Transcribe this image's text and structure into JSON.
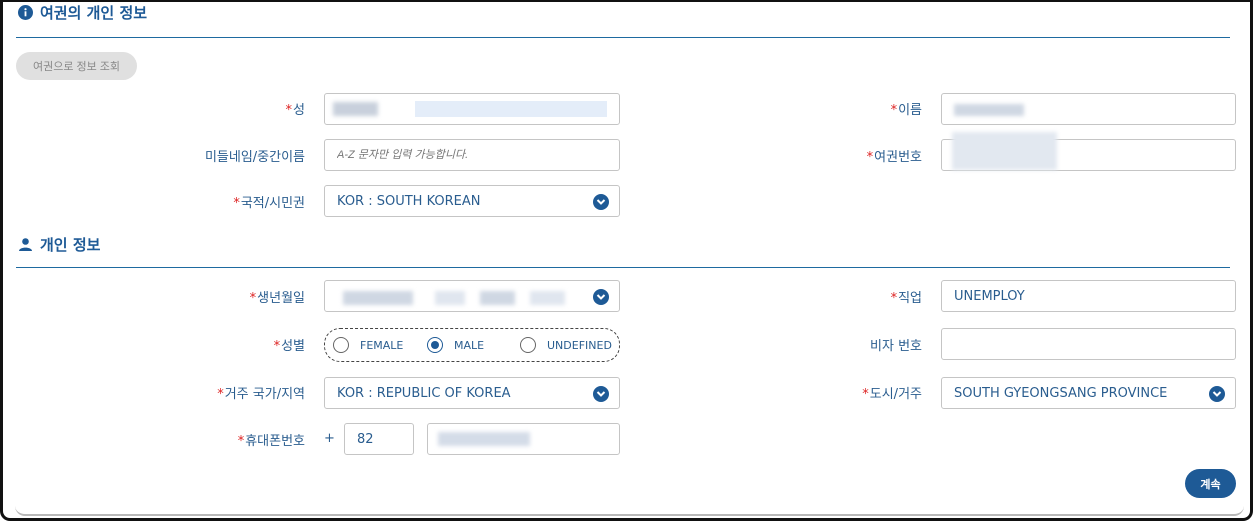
{
  "passport_section": {
    "title": "여권의 개인 정보",
    "lookup_button": "여권으로 정보 조회",
    "surname_label": "성",
    "given_name_label": "이름",
    "middle_name_label": "미들네임/중간이름",
    "middle_name_placeholder": "A-Z 문자만 입력 가능합니다.",
    "passport_no_label": "여권번호",
    "nationality_label": "국적/시민권",
    "nationality_value": "KOR : SOUTH KOREAN"
  },
  "personal_section": {
    "title": "개인 정보",
    "dob_label": "생년월일",
    "occupation_label": "직업",
    "occupation_value": "UNEMPLOY",
    "gender_label": "성별",
    "gender_options": [
      "FEMALE",
      "MALE",
      "UNDEFINED"
    ],
    "gender_selected": "MALE",
    "visa_no_label": "비자 번호",
    "visa_no_value": "",
    "residence_country_label": "거주 국가/지역",
    "residence_country_value": "KOR : REPUBLIC OF KOREA",
    "city_label": "도시/거주",
    "city_value": "SOUTH GYEONGSANG PROVINCE",
    "phone_label": "휴대폰번호",
    "phone_plus": "+",
    "phone_country_code": "82"
  },
  "actions": {
    "continue_label": "계속"
  },
  "colors": {
    "primary": "#1e5a96",
    "required_mark": "#dd2222",
    "label": "#2a5d8f"
  }
}
